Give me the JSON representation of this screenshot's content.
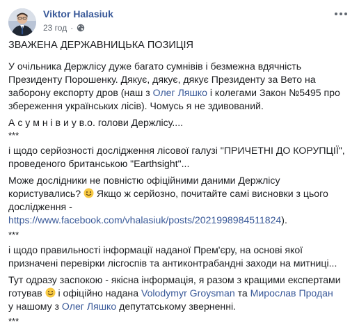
{
  "post": {
    "author": "Viktor Halasiuk",
    "time": "23 год",
    "dot": "·",
    "title": "ЗВАЖЕНА ДЕРЖАВНИЦЬКА ПОЗИЦІЯ",
    "p1_a": "У очільника Держлісу дуже багато сумнівів і безмежна вдячність Президенту Порошенку. Дякує, дякує, дякує Президенту за Вето на заборону експорту дров (наш з ",
    "p1_link": "Олег Ляшко",
    "p1_b": " і колегами Закон №5495 про збереження українських лісів). Чомусь я не здивований.",
    "p2": "А с у м н і в и у в.о. голови Держлісу....",
    "sep1": "***",
    "p3": "і щодо серйозності дослідження лісової галузі \"ПРИЧЕТНІ ДО КОРУПЦІЇ\", проведеного британською \"Earthsight\"...",
    "p4_a": "Може дослідники не повністю офіційними даними Держлісу користувались? ",
    "p4_b": " Якщо ж серйозно, почитайте самі висновки з цього дослідження - ",
    "p4_link": "https://www.facebook.com/vhalasiuk/posts/2021998984511824",
    "p4_c": ").",
    "sep2": "***",
    "p5": "і щодо правильності інформації наданої Прем'єру, на основі якої призначені перевірки лісгоспів та антиконтрабандні заходи на митниці...",
    "p6_a": "Тут одразу заспокою - якісна інформація, я разом з кращими експертами готував ",
    "p6_b": " і офіційно надана ",
    "p6_link1": "Volodymyr Groysman",
    "p6_c": " та ",
    "p6_link2": "Мирослав Продан",
    "p6_d": "у нашому з ",
    "p6_link3": "Олег Ляшко",
    "p6_e": " депутатському зверненні.",
    "sep3": "***"
  },
  "icons": {
    "avatar": "avatar",
    "globe": "globe-icon",
    "more": "more-options-icon",
    "emoji": "smile-emoji-icon"
  },
  "colors": {
    "link": "#385898",
    "text": "#1c1e21",
    "meta": "#606770"
  }
}
